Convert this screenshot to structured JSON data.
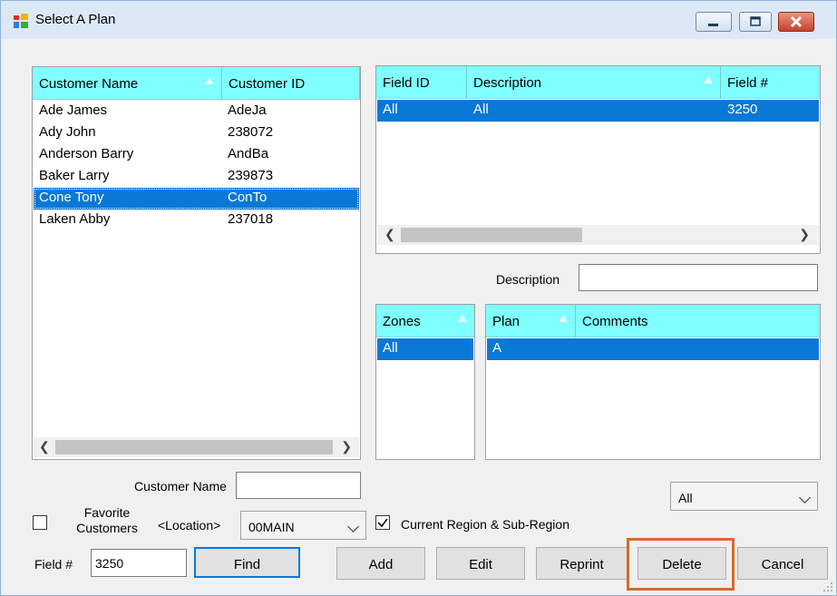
{
  "window": {
    "title": "Select A Plan"
  },
  "customers": {
    "columns": [
      "Customer Name",
      "Customer ID"
    ],
    "rows": [
      {
        "name": "Ade James",
        "id": "AdeJa"
      },
      {
        "name": "Ady John",
        "id": "238072"
      },
      {
        "name": "Anderson Barry",
        "id": "AndBa"
      },
      {
        "name": "Baker Larry",
        "id": "239873"
      },
      {
        "name": "Cone Tony",
        "id": "ConTo"
      },
      {
        "name": "Laken Abby",
        "id": "237018"
      }
    ],
    "selected_index": 4
  },
  "fields": {
    "columns": [
      "Field ID",
      "Description",
      "Field #"
    ],
    "rows": [
      {
        "field_id": "All",
        "description": "All",
        "field_num": "3250"
      }
    ]
  },
  "description": {
    "label": "Description",
    "value": ""
  },
  "zones": {
    "column": "Zones",
    "rows": [
      "All"
    ]
  },
  "plans": {
    "columns": [
      "Plan",
      "Comments"
    ],
    "rows": [
      {
        "plan": "A",
        "comments": ""
      }
    ]
  },
  "filters": {
    "customer_name_label": "Customer Name",
    "customer_name_value": "",
    "favorite_label_1": "Favorite",
    "favorite_label_2": "Customers",
    "favorite_checked": false,
    "location_label": "<Location>",
    "location_value": "00MAIN",
    "region_label": "Current Region & Sub-Region",
    "region_checked": true,
    "plan_filter_value": "All",
    "field_num_label": "Field #",
    "field_num_value": "3250"
  },
  "buttons": {
    "find": "Find",
    "add": "Add",
    "edit": "Edit",
    "reprint": "Reprint",
    "delete": "Delete",
    "cancel": "Cancel"
  },
  "colors": {
    "header": "#7fffff",
    "selection": "#0a78d7",
    "highlight": "#d9682b"
  }
}
